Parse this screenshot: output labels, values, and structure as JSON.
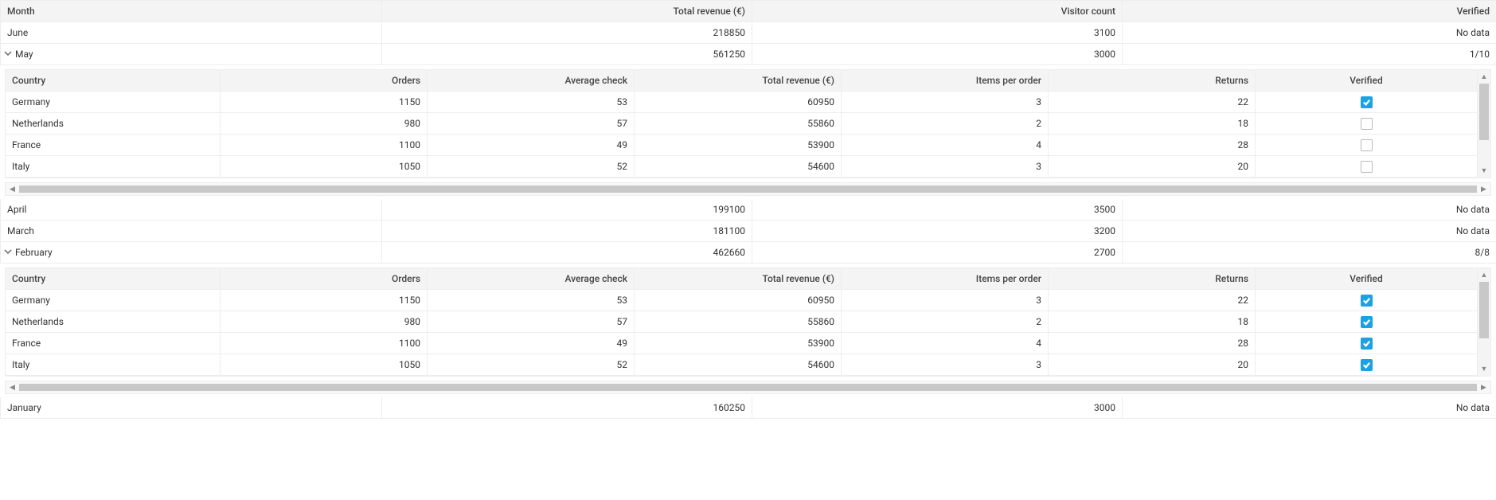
{
  "outer_headers": {
    "month": "Month",
    "revenue": "Total revenue (€)",
    "visitors": "Visitor count",
    "verified": "Verified"
  },
  "inner_headers": {
    "country": "Country",
    "orders": "Orders",
    "avg": "Average check",
    "rev": "Total revenue (€)",
    "ipo": "Items per order",
    "ret": "Returns",
    "ver": "Verified"
  },
  "months": {
    "june": {
      "label": "June",
      "revenue": "218850",
      "visitors": "3100",
      "verified": "No data"
    },
    "may": {
      "label": "May",
      "revenue": "561250",
      "visitors": "3000",
      "verified": "1/10"
    },
    "april": {
      "label": "April",
      "revenue": "199100",
      "visitors": "3500",
      "verified": "No data"
    },
    "march": {
      "label": "March",
      "revenue": "181100",
      "visitors": "3200",
      "verified": "No data"
    },
    "february": {
      "label": "February",
      "revenue": "462660",
      "visitors": "2700",
      "verified": "8/8"
    },
    "january": {
      "label": "January",
      "revenue": "160250",
      "visitors": "3000",
      "verified": "No data"
    }
  },
  "may_rows": [
    {
      "country": "Germany",
      "orders": "1150",
      "avg": "53",
      "rev": "60950",
      "ipo": "3",
      "ret": "22",
      "checked": true
    },
    {
      "country": "Netherlands",
      "orders": "980",
      "avg": "57",
      "rev": "55860",
      "ipo": "2",
      "ret": "18",
      "checked": false
    },
    {
      "country": "France",
      "orders": "1100",
      "avg": "49",
      "rev": "53900",
      "ipo": "4",
      "ret": "28",
      "checked": false
    },
    {
      "country": "Italy",
      "orders": "1050",
      "avg": "52",
      "rev": "54600",
      "ipo": "3",
      "ret": "20",
      "checked": false
    }
  ],
  "feb_rows": [
    {
      "country": "Germany",
      "orders": "1150",
      "avg": "53",
      "rev": "60950",
      "ipo": "3",
      "ret": "22",
      "checked": true
    },
    {
      "country": "Netherlands",
      "orders": "980",
      "avg": "57",
      "rev": "55860",
      "ipo": "2",
      "ret": "18",
      "checked": true
    },
    {
      "country": "France",
      "orders": "1100",
      "avg": "49",
      "rev": "53900",
      "ipo": "4",
      "ret": "28",
      "checked": true
    },
    {
      "country": "Italy",
      "orders": "1050",
      "avg": "52",
      "rev": "54600",
      "ipo": "3",
      "ret": "20",
      "checked": true
    }
  ]
}
